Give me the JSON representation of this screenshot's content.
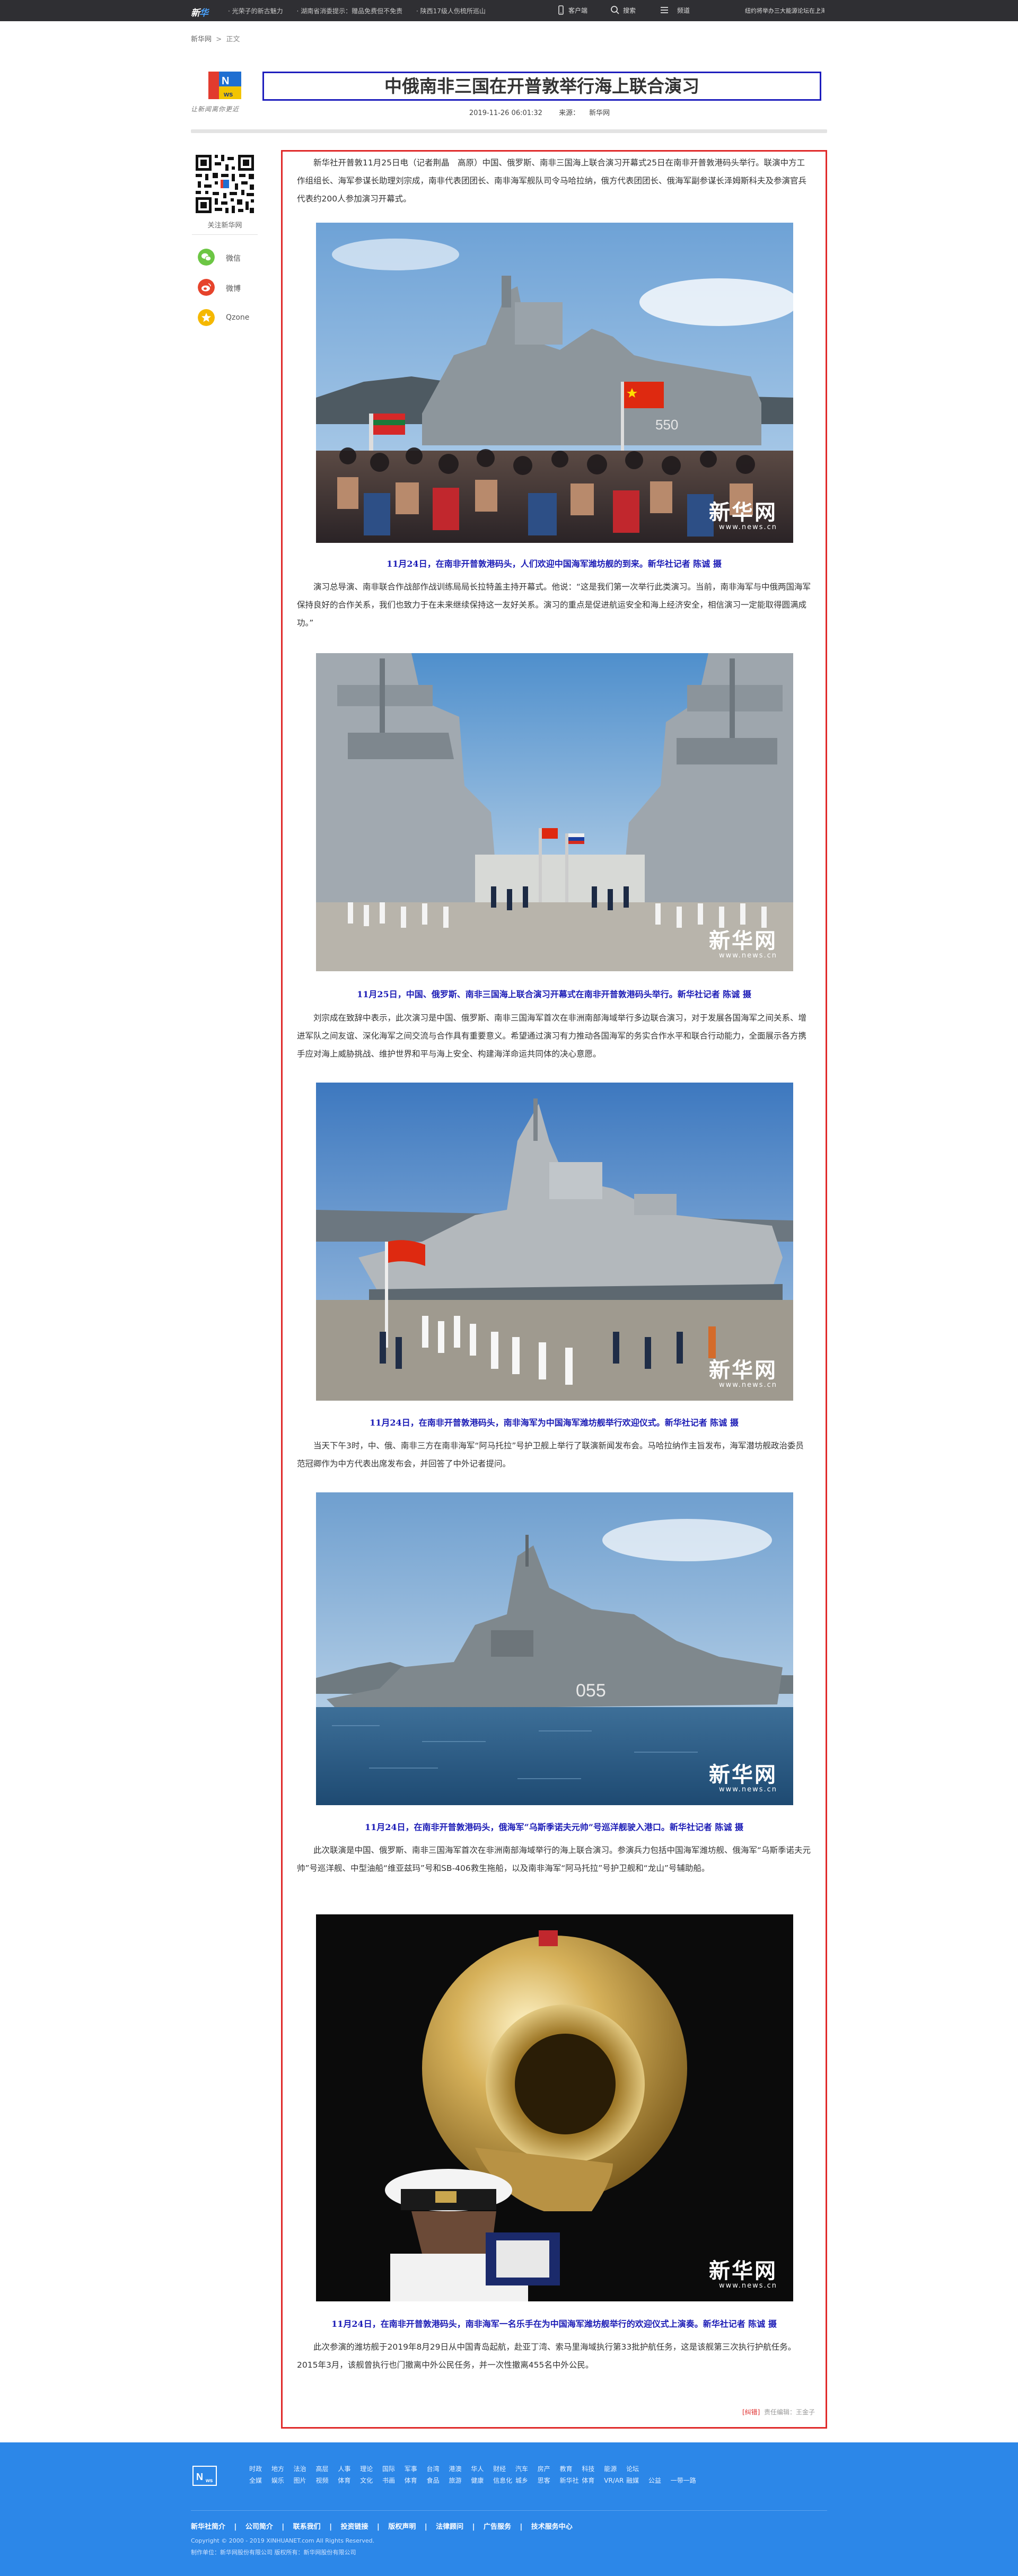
{
  "topbar": {
    "logo": "新华网",
    "ticker": [
      "· 光荣子的新古魅力",
      "· 湖南省消委提示：赠品免费但不免责",
      "· 陕西17级人伤梳所巡山"
    ],
    "client_label": "客户端",
    "search_label": "搜索",
    "channel_label": "频道",
    "hot_text": "纽约将举办三大能源论坛在上海"
  },
  "breadcrumb": {
    "home": "新华网",
    "sep": ">",
    "current": "正文"
  },
  "header": {
    "slogan": "让新闻离你更近",
    "title": "中俄南非三国在开普敦举行海上联合演习",
    "date": "2019-11-26 06:01:32",
    "source_label": "来源：",
    "source": "新华网"
  },
  "share": {
    "qr_label": "关注新华网",
    "items": [
      {
        "label": "微信",
        "icon": "wechat-icon",
        "color": "#6cc644"
      },
      {
        "label": "微博",
        "icon": "weibo-icon",
        "color": "#e6432b"
      },
      {
        "label": "Qzone",
        "icon": "qzone-icon",
        "color": "#f5b800"
      }
    ]
  },
  "article": {
    "paragraphs": [
      "新华社开普敦11月25日电（记者荆晶　高原）中国、俄罗斯、南非三国海上联合演习开幕式25日在南非开普敦港码头举行。联演中方工作组组长、海军参谋长助理刘宗成，南非代表团团长、南非海军舰队司令马哈拉纳，俄方代表团团长、俄海军副参谋长泽姆斯科夫及参演官兵代表约200人参加演习开幕式。",
      "演习总导演、南非联合作战部作战训练局局长拉特盖主持开幕式。他说：“这是我们第一次举行此类演习。当前，南非海军与中俄两国海军保持良好的合作关系，我们也致力于在未来继续保持这一友好关系。演习的重点是促进航运安全和海上经济安全，相信演习一定能取得圆满成功。”",
      "刘宗成在致辞中表示，此次演习是中国、俄罗斯、南非三国海军首次在非洲南部海域举行多边联合演习，对于发展各国海军之间关系、增进军队之间友谊、深化海军之间交流与合作具有重要意义。希望通过演习有力推动各国海军的务实合作水平和联合行动能力，全面展示各方携手应对海上威胁挑战、维护世界和平与海上安全、构建海洋命运共同体的决心意愿。",
      "当天下午3时，中、俄、南非三方在南非海军“阿马托拉”号护卫舰上举行了联演新闻发布会。马哈拉纳作主旨发布，海军潜坊舰政治委员范冠卿作为中方代表出席发布会，并回答了中外记者提问。",
      "此次联演是中国、俄罗斯、南非三国海军首次在非洲南部海域举行的海上联合演习。参演兵力包括中国海军潍坊舰、俄海军“乌斯季诺夫元帅”号巡洋舰、中型油船“维亚兹玛”号和SB-406救生拖船，以及南非海军“阿马托拉”号护卫舰和“龙山”号辅助船。",
      "此次参演的潍坊舰于2019年8月29日从中国青岛起航，赴亚丁湾、索马里海域执行第33批护航任务，这是该舰第三次执行护航任务。2015年3月，该舰曾执行也门撤离中外公民任务，并一次性撤离455名中外公民。"
    ],
    "captions": [
      "11月24日，在南非开普敦港码头，人们欢迎中国海军潍坊舰的到来。新华社记者 陈诚 摄",
      "11月25日，中国、俄罗斯、南非三国海上联合演习开幕式在南非开普敦港码头举行。新华社记者 陈诚 摄",
      "11月24日，在南非开普敦港码头，南非海军为中国海军潍坊舰举行欢迎仪式。新华社记者 陈诚 摄",
      "11月24日，在南非开普敦港码头，俄海军“乌斯季诺夫元帅”号巡洋舰驶入港口。新华社记者 陈诚 摄",
      "11月24日，在南非开普敦港码头，南非海军一名乐手在为中国海军潍坊舰举行的欢迎仪式上演奏。新华社记者 陈诚 摄"
    ],
    "watermark_big": "新华网",
    "watermark_small": "www.news.cn",
    "hull_number_1": "550",
    "hull_number_4": "055",
    "footer_tag": "[纠错]",
    "footer_editor": "责任编辑：王金子"
  },
  "footer": {
    "logo": "新华网",
    "nav_rows": [
      [
        "时政",
        "地方",
        "法治",
        "高层",
        "人事",
        "理论",
        "国际",
        "军事",
        "台湾",
        "港澳",
        "华人",
        "财经",
        "汽车",
        "房产",
        "教育",
        "科技",
        "能源",
        "论坛"
      ],
      [
        "全媒",
        "娱乐",
        "图片",
        "视频",
        "体育",
        "文化",
        "书画",
        "体育",
        "食品",
        "旅游",
        "健康",
        "信息化",
        "城乡",
        "思客",
        "新华社",
        "体育",
        "VR/AR",
        "融媒",
        "公益",
        "一带一路"
      ]
    ],
    "links": [
      "新华社简介",
      "|",
      "公司简介",
      "|",
      "联系我们",
      "|",
      "投资链接",
      "|",
      "版权声明",
      "|",
      "法律顾问",
      "|",
      "广告服务",
      "|",
      "技术服务中心"
    ],
    "copyright": "Copyright © 2000 - 2019 XINHUANET.com   All Rights Reserved.",
    "corp": "制作单位：新华网股份有限公司     版权所有：新华网股份有限公司"
  },
  "colors": {
    "topbar": "#2f2f33",
    "title_border": "#1d1dbd",
    "article_border": "#e02a2a",
    "caption": "#1b1bb6",
    "footer": "#2c87e8"
  }
}
